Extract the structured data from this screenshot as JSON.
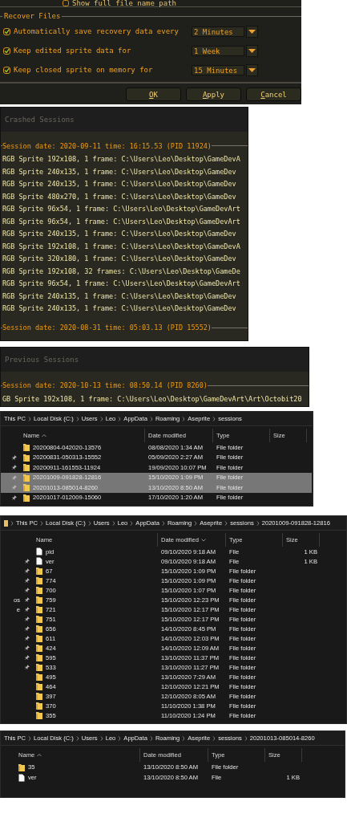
{
  "preferences": {
    "partial_option": {
      "label": "Show full file name path"
    },
    "section_title": "Recover Files",
    "options": [
      {
        "label": "Automatically save recovery data every",
        "checked": true,
        "value": "2 Minutes"
      },
      {
        "label": "Keep edited sprite data for",
        "checked": true,
        "value": "1 Week"
      },
      {
        "label": "Keep closed sprite on memory for",
        "checked": true,
        "value": "15 Minutes"
      }
    ],
    "buttons": [
      {
        "label": "OK"
      },
      {
        "label": "Apply"
      },
      {
        "label": "Cancel"
      }
    ]
  },
  "crashed_sessions": {
    "title": "Crashed Sessions",
    "sessions": [
      {
        "header": "Session date: 2020-09-11 time: 16:15.53 (PID 11924)",
        "sprites": [
          "RGB Sprite 192x108, 1 frame: C:\\Users\\Leo\\Desktop\\GameDevA",
          "RGB Sprite 240x135, 1 frame: C:\\Users\\Leo\\Desktop\\GameDev",
          "RGB Sprite 240x135, 1 frame: C:\\Users\\Leo\\Desktop\\GameDev",
          "RGB Sprite 480x270, 1 frame: C:\\Users\\Leo\\Desktop\\GameDev",
          "RGB Sprite 96x54, 1 frame: C:\\Users\\Leo\\Desktop\\GameDevArt",
          "RGB Sprite 96x54, 1 frame: C:\\Users\\Leo\\Desktop\\GameDevArt",
          "RGB Sprite 240x135, 1 frame: C:\\Users\\Leo\\Desktop\\GameDev",
          "RGB Sprite 192x108, 1 frame: C:\\Users\\Leo\\Desktop\\GameDevA",
          "RGB Sprite 320x180, 1 frame: C:\\Users\\Leo\\Desktop\\GameDev",
          "RGB Sprite 192x108, 32 frames: C:\\Users\\Leo\\Desktop\\GameDe",
          "RGB Sprite 96x54, 1 frame: C:\\Users\\Leo\\Desktop\\GameDevArt",
          "RGB Sprite 240x135, 1 frame: C:\\Users\\Leo\\Desktop\\GameDev",
          "RGB Sprite 240x135, 1 frame: C:\\Users\\Leo\\Desktop\\GameDev"
        ]
      },
      {
        "header": "Session date: 2020-08-31 time: 05:03.13 (PID 15552)"
      }
    ]
  },
  "previous_sessions": {
    "title": "Previous Sessions",
    "sessions": [
      {
        "header": "Session date: 2020-10-13 time: 08:50.14 (PID 8260)",
        "sprites": [
          "GB Sprite 192x108, 1 frame: C:\\Users\\Leo\\Desktop\\GameDevArt\\Art\\Octobit20"
        ]
      }
    ]
  },
  "explorers": [
    {
      "breadcrumb": [
        "This PC",
        "Local Disk (C:)",
        "Users",
        "Leo",
        "AppData",
        "Roaming",
        "Aseprite",
        "sessions"
      ],
      "nav_pins": true,
      "sort_descending": false,
      "columns": [
        {
          "label": "Name",
          "sorted": true
        },
        {
          "label": "Date modified",
          "sorted": false
        },
        {
          "label": "Type",
          "sorted": false
        },
        {
          "label": "Size",
          "sorted": false
        }
      ],
      "rows": [
        {
          "kind": "folder",
          "name": "20200804-042020-13576",
          "date": "08/08/2020 1:34 AM",
          "type": "File folder",
          "selected": false
        },
        {
          "kind": "folder",
          "name": "20200831-050313-15552",
          "date": "05/09/2020 2:27 AM",
          "type": "File folder",
          "selected": false
        },
        {
          "kind": "folder",
          "name": "20200911-161553-11924",
          "date": "19/09/2020 10:07 PM",
          "type": "File folder",
          "selected": false
        },
        {
          "kind": "folder",
          "name": "20201009-091828-12816",
          "date": "15/10/2020 1:09 PM",
          "type": "File folder",
          "selected": true
        },
        {
          "kind": "folder",
          "name": "20201013-085014-8260",
          "date": "13/10/2020 8:50 AM",
          "type": "File folder",
          "selected": true
        },
        {
          "kind": "folder",
          "name": "20201017-012009-15060",
          "date": "17/10/2020 1:20 AM",
          "type": "File folder",
          "selected": false
        }
      ]
    },
    {
      "breadcrumb": [
        "This PC",
        "Local Disk (C:)",
        "Users",
        "Leo",
        "AppData",
        "Roaming",
        "Aseprite",
        "sessions",
        "20201009-091828-12816"
      ],
      "nav_pins": true,
      "nav_labels": [
        "os",
        "e"
      ],
      "sort_descending": true,
      "columns": [
        {
          "label": "Name",
          "sorted": false
        },
        {
          "label": "Date modified",
          "sorted": true
        },
        {
          "label": "Type",
          "sorted": false
        },
        {
          "label": "Size",
          "sorted": false
        }
      ],
      "rows": [
        {
          "kind": "file",
          "name": "pid",
          "date": "09/10/2020 9:18 AM",
          "type": "File",
          "size": "1 KB",
          "selected": false
        },
        {
          "kind": "file",
          "name": "ver",
          "date": "09/10/2020 9:18 AM",
          "type": "File",
          "size": "1 KB",
          "selected": false
        },
        {
          "kind": "folder",
          "name": "67",
          "date": "15/10/2020 1:09 PM",
          "type": "File folder",
          "selected": false
        },
        {
          "kind": "folder",
          "name": "774",
          "date": "15/10/2020 1:09 PM",
          "type": "File folder",
          "selected": false
        },
        {
          "kind": "folder",
          "name": "700",
          "date": "15/10/2020 1:07 PM",
          "type": "File folder",
          "selected": false
        },
        {
          "kind": "folder",
          "name": "759",
          "date": "15/10/2020 12:23 PM",
          "type": "File folder",
          "selected": false
        },
        {
          "kind": "folder",
          "name": "721",
          "date": "15/10/2020 12:17 PM",
          "type": "File folder",
          "selected": false
        },
        {
          "kind": "folder",
          "name": "751",
          "date": "15/10/2020 12:17 PM",
          "type": "File folder",
          "selected": false
        },
        {
          "kind": "folder",
          "name": "656",
          "date": "14/10/2020 8:45 PM",
          "type": "File folder",
          "selected": false
        },
        {
          "kind": "folder",
          "name": "611",
          "date": "14/10/2020 12:03 PM",
          "type": "File folder",
          "selected": false
        },
        {
          "kind": "folder",
          "name": "424",
          "date": "14/10/2020 12:09 AM",
          "type": "File folder",
          "selected": false
        },
        {
          "kind": "folder",
          "name": "595",
          "date": "13/10/2020 11:37 PM",
          "type": "File folder",
          "selected": false
        },
        {
          "kind": "folder",
          "name": "533",
          "date": "13/10/2020 11:27 PM",
          "type": "File folder",
          "selected": false
        },
        {
          "kind": "folder",
          "name": "495",
          "date": "13/10/2020 7:29 AM",
          "type": "File folder",
          "selected": false
        },
        {
          "kind": "folder",
          "name": "464",
          "date": "12/10/2020 12:21 PM",
          "type": "File folder",
          "selected": false
        },
        {
          "kind": "folder",
          "name": "397",
          "date": "12/10/2020 8:05 AM",
          "type": "File folder",
          "selected": false
        },
        {
          "kind": "folder",
          "name": "370",
          "date": "11/10/2020 1:38 PM",
          "type": "File folder",
          "selected": false
        },
        {
          "kind": "folder",
          "name": "355",
          "date": "11/10/2020 1:24 PM",
          "type": "File folder",
          "selected": false
        }
      ]
    },
    {
      "breadcrumb": [
        "This PC",
        "Local Disk (C:)",
        "Users",
        "Leo",
        "AppData",
        "Roaming",
        "Aseprite",
        "sessions",
        "20201013-085014-8260"
      ],
      "nav_pins": false,
      "sort_descending": false,
      "columns": [
        {
          "label": "Name",
          "sorted": true
        },
        {
          "label": "Date modified",
          "sorted": false
        },
        {
          "label": "Type",
          "sorted": false
        },
        {
          "label": "Size",
          "sorted": false
        }
      ],
      "rows": [
        {
          "kind": "folder",
          "name": "35",
          "date": "13/10/2020 8:50 AM",
          "type": "File folder",
          "selected": false
        },
        {
          "kind": "file",
          "name": "ver",
          "date": "13/10/2020 8:50 AM",
          "type": "File",
          "size": "1 KB",
          "selected": false
        }
      ]
    }
  ]
}
